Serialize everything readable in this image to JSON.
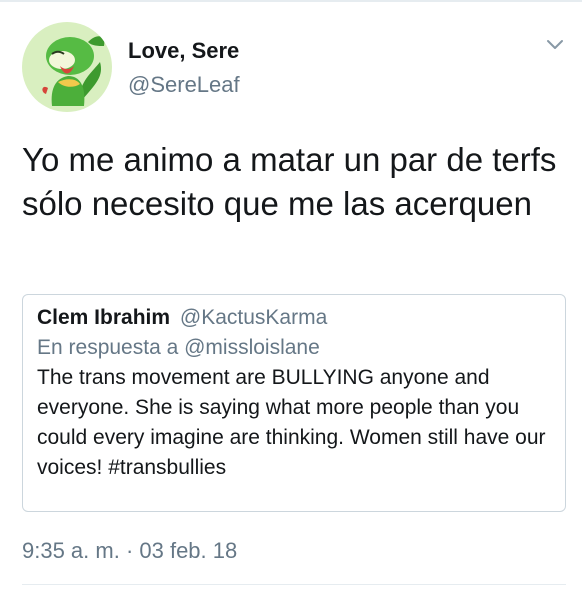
{
  "tweet": {
    "author": {
      "display_name": "Love, Sere",
      "handle": "@SereLeaf",
      "avatar_icon": "snivy-avatar-icon"
    },
    "menu_icon": "chevron-down-icon",
    "text": "Yo me animo a matar un par de terfs sólo necesito que me las acerquen",
    "quoted": {
      "display_name": "Clem Ibrahim",
      "handle": "@KactusKarma",
      "reply_context": "En respuesta a @missloislane",
      "text": "The trans movement are BULLYING anyone and everyone. She is saying what more people than you could every imagine are thinking. Women still have our voices! #transbullies"
    },
    "timestamp": "9:35 a. m. · 03 feb. 18"
  },
  "colors": {
    "text": "#14171a",
    "secondary_text": "#657786",
    "border": "#ccd6dd",
    "avatar_background": "#d9efc0",
    "avatar_character": "#4caf3a"
  }
}
